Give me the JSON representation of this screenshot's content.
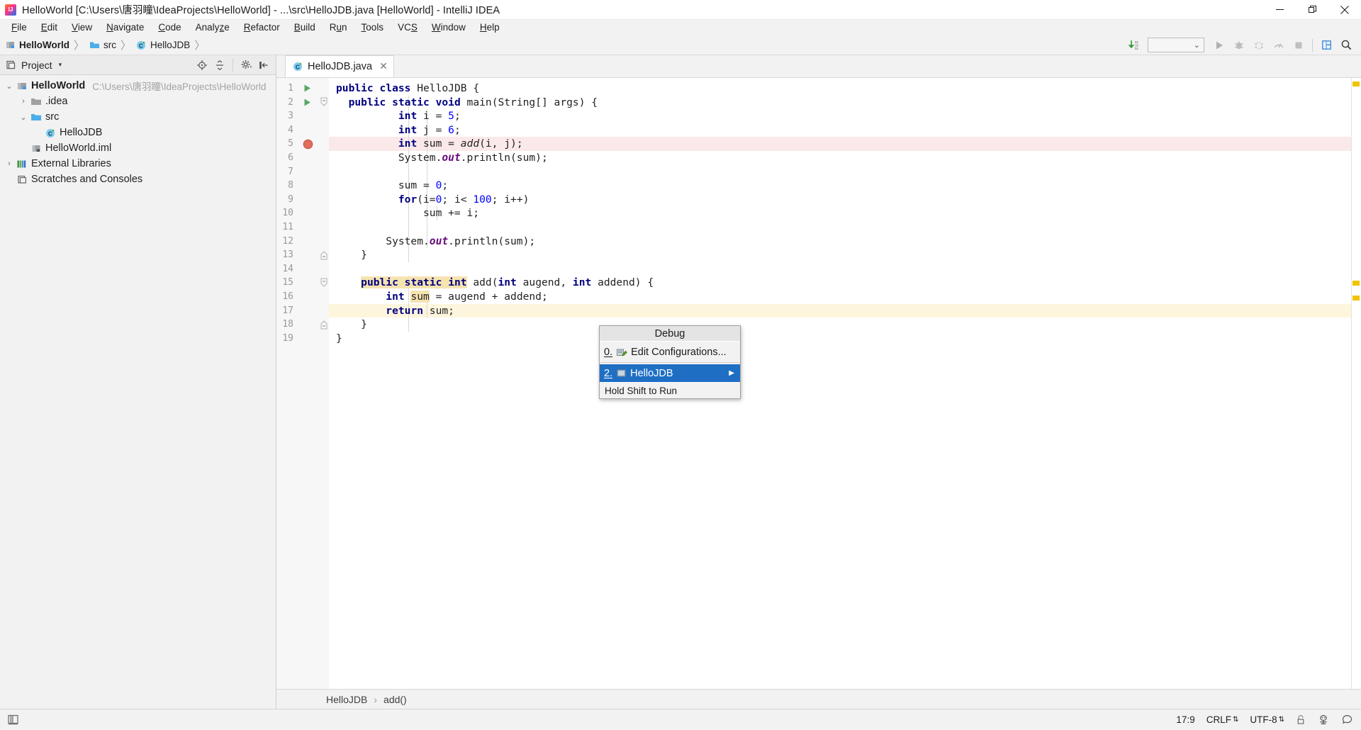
{
  "window": {
    "title": "HelloWorld [C:\\Users\\唐羽瞳\\IdeaProjects\\HelloWorld] - ...\\src\\HelloJDB.java [HelloWorld] - IntelliJ IDEA",
    "logo_icon": "intellij-idea-logo",
    "minimize_label": "—",
    "maximize_label": "❐",
    "close_label": "✕"
  },
  "menubar": {
    "items": [
      {
        "label": "File",
        "mnemonic": "F"
      },
      {
        "label": "Edit",
        "mnemonic": "E"
      },
      {
        "label": "View",
        "mnemonic": "V"
      },
      {
        "label": "Navigate",
        "mnemonic": "N"
      },
      {
        "label": "Code",
        "mnemonic": "C"
      },
      {
        "label": "Analyze",
        "mnemonic": "z"
      },
      {
        "label": "Refactor",
        "mnemonic": "R"
      },
      {
        "label": "Build",
        "mnemonic": "B"
      },
      {
        "label": "Run",
        "mnemonic": "u"
      },
      {
        "label": "Tools",
        "mnemonic": "T"
      },
      {
        "label": "VCS",
        "mnemonic": "S"
      },
      {
        "label": "Window",
        "mnemonic": "W"
      },
      {
        "label": "Help",
        "mnemonic": "H"
      }
    ]
  },
  "navbar": {
    "crumbs": [
      {
        "label": "HelloWorld",
        "icon": "module-icon",
        "bold": true
      },
      {
        "label": "src",
        "icon": "folder-icon",
        "bold": false
      },
      {
        "label": "HelloJDB",
        "icon": "java-class-icon",
        "bold": false
      }
    ],
    "separator": "〉",
    "toolbar": {
      "update_icon": "update-project-icon",
      "run_config_selected": "",
      "run_config_caret": "⌄",
      "run_icon": "run-icon",
      "debug_icon": "debug-icon",
      "coverage_icon": "run-with-coverage-icon",
      "profile_icon": "profiler-icon",
      "stop_icon": "stop-icon",
      "layout_icon": "settings-layout-icon",
      "search_icon": "search-everywhere-icon"
    }
  },
  "sidebar": {
    "header": {
      "icon": "project-panel-icon",
      "title": "Project",
      "caret": "▾",
      "tools": [
        {
          "icon": "locate-icon"
        },
        {
          "icon": "collapse-all-icon"
        },
        {
          "icon": "gear-icon"
        },
        {
          "icon": "hide-panel-icon"
        }
      ]
    },
    "tree": [
      {
        "label": "HelloWorld",
        "path": "C:\\Users\\唐羽瞳\\IdeaProjects\\HelloWorld",
        "twisty": "⌄",
        "icon": "module-icon",
        "indent": 0,
        "bold": true,
        "selected": false
      },
      {
        "label": ".idea",
        "path": "",
        "twisty": "›",
        "icon": "folder-gray-icon",
        "indent": 1,
        "bold": false,
        "selected": false
      },
      {
        "label": "src",
        "path": "",
        "twisty": "⌄",
        "icon": "folder-source-icon",
        "indent": 1,
        "bold": false,
        "selected": false
      },
      {
        "label": "HelloJDB",
        "path": "",
        "twisty": "",
        "icon": "java-class-icon",
        "indent": 2,
        "bold": false,
        "selected": false
      },
      {
        "label": "HelloWorld.iml",
        "path": "",
        "twisty": "",
        "icon": "iml-file-icon",
        "indent": 1,
        "bold": false,
        "selected": false
      },
      {
        "label": "External Libraries",
        "path": "",
        "twisty": "›",
        "icon": "libraries-icon",
        "indent": 0,
        "bold": false,
        "selected": false
      },
      {
        "label": "Scratches and Consoles",
        "path": "",
        "twisty": "",
        "icon": "scratches-icon",
        "indent": 0,
        "bold": false,
        "selected": false
      }
    ]
  },
  "editor": {
    "tab": {
      "label": "HelloJDB.java",
      "icon": "java-class-icon",
      "close": "✕"
    },
    "lines": [
      {
        "n": "1",
        "gutter": "run-gutter-icon",
        "fold": "",
        "hl": "",
        "indent": 0
      },
      {
        "n": "2",
        "gutter": "run-gutter-icon",
        "fold": "fold-open",
        "hl": "",
        "indent": 1
      },
      {
        "n": "3",
        "gutter": "",
        "fold": "",
        "hl": "",
        "indent": 2
      },
      {
        "n": "4",
        "gutter": "",
        "fold": "",
        "hl": "",
        "indent": 2
      },
      {
        "n": "5",
        "gutter": "breakpoint-icon",
        "fold": "",
        "hl": "red",
        "indent": 2
      },
      {
        "n": "6",
        "gutter": "",
        "fold": "",
        "hl": "",
        "indent": 2
      },
      {
        "n": "7",
        "gutter": "",
        "fold": "",
        "hl": "",
        "indent": 0
      },
      {
        "n": "8",
        "gutter": "",
        "fold": "",
        "hl": "",
        "indent": 2
      },
      {
        "n": "9",
        "gutter": "",
        "fold": "",
        "hl": "",
        "indent": 2
      },
      {
        "n": "10",
        "gutter": "",
        "fold": "",
        "hl": "",
        "indent": 3
      },
      {
        "n": "11",
        "gutter": "",
        "fold": "",
        "hl": "",
        "indent": 0
      },
      {
        "n": "12",
        "gutter": "",
        "fold": "",
        "hl": "",
        "indent": 2
      },
      {
        "n": "13",
        "gutter": "",
        "fold": "fold-end",
        "hl": "",
        "indent": 1
      },
      {
        "n": "14",
        "gutter": "",
        "fold": "",
        "hl": "",
        "indent": 0
      },
      {
        "n": "15",
        "gutter": "",
        "fold": "fold-open",
        "hl": "",
        "indent": 1
      },
      {
        "n": "16",
        "gutter": "",
        "fold": "",
        "hl": "",
        "indent": 2
      },
      {
        "n": "17",
        "gutter": "",
        "fold": "",
        "hl": "yellow",
        "indent": 2
      },
      {
        "n": "18",
        "gutter": "",
        "fold": "fold-end",
        "hl": "",
        "indent": 1
      },
      {
        "n": "19",
        "gutter": "",
        "fold": "",
        "hl": "",
        "indent": 0
      }
    ],
    "code_text": [
      "public class HelloJDB {",
      "  public static void main(String[] args) {",
      "          int i = 5;",
      "          int j = 6;",
      "          int sum = add(i, j);",
      "          System.out.println(sum);",
      "",
      "          sum = 0;",
      "          for(i=0; i< 100; i++)",
      "              sum += i;",
      "",
      "        System.out.println(sum);",
      "    }",
      "",
      "    public static int add(int augend, int addend) {",
      "        int sum = augend + addend;",
      "        return sum;",
      "    }",
      "}"
    ],
    "breadcrumb": {
      "class": "HelloJDB",
      "separator": "›",
      "method": "add()"
    }
  },
  "popup": {
    "title": "Debug",
    "items": [
      {
        "mnemonic": "0.",
        "label": "Edit Configurations...",
        "icon": "edit-configurations-icon",
        "selected": false,
        "submenu": false
      },
      {
        "mnemonic": "2.",
        "label": "HelloJDB",
        "icon": "java-run-config-icon",
        "selected": true,
        "submenu": true
      }
    ],
    "footer": "Hold Shift to Run",
    "submenu_arrow": "▶",
    "accent_color": "#1e6fc4"
  },
  "statusbar": {
    "left_icon": "toggle-toolwindows-icon",
    "position": "17:9",
    "line_separator": "CRLF",
    "encoding": "UTF-8",
    "spin": "⇅",
    "lock_icon": "read-only-lock-icon",
    "hector_icon": "inspection-hector-icon",
    "event_log_icon": "event-log-icon"
  }
}
